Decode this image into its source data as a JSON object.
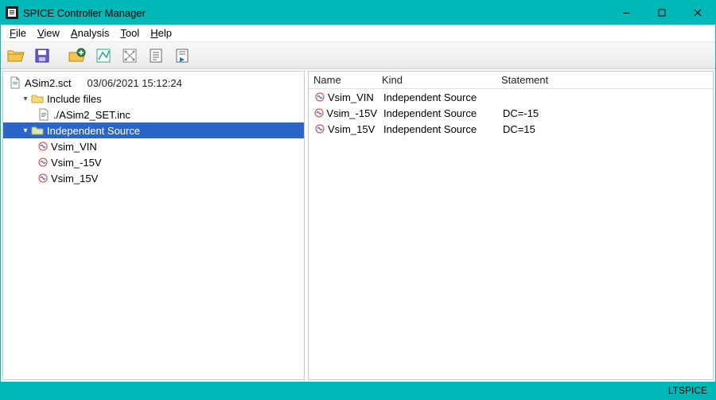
{
  "window": {
    "title": "SPICE Controller Manager"
  },
  "menu": {
    "file": "File",
    "view": "View",
    "analysis": "Analysis",
    "tool": "Tool",
    "help": "Help"
  },
  "tree": {
    "root_file": "ASim2.sct",
    "root_timestamp": "03/06/2021 15:12:24",
    "include_label": "Include files",
    "include_items": [
      {
        "label": "./ASim2_SET.inc"
      }
    ],
    "indep_label": "Independent Source",
    "indep_items": [
      {
        "label": "Vsim_VIN"
      },
      {
        "label": "Vsim_-15V"
      },
      {
        "label": "Vsim_15V"
      }
    ]
  },
  "list": {
    "headers": {
      "name": "Name",
      "kind": "Kind",
      "statement": "Statement"
    },
    "rows": [
      {
        "name": "Vsim_VIN",
        "kind": "Independent Source",
        "statement": ""
      },
      {
        "name": "Vsim_-15V",
        "kind": "Independent Source",
        "statement": "DC=-15"
      },
      {
        "name": "Vsim_15V",
        "kind": "Independent Source",
        "statement": "DC=15"
      }
    ]
  },
  "status": {
    "right": "LTSPICE"
  }
}
